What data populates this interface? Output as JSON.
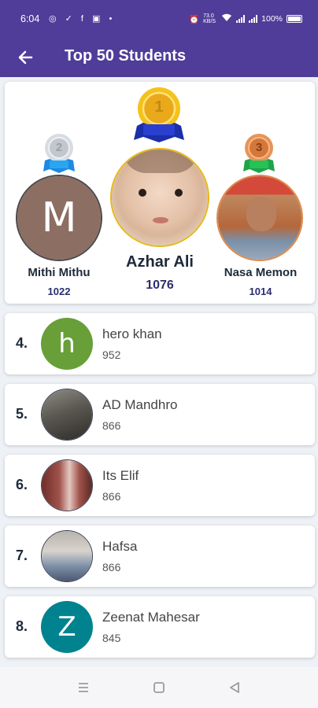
{
  "status_bar": {
    "time": "6:04",
    "icons": "◎ ✓ f ▣ •",
    "network_speed": "73.0 KB/S",
    "battery": "100%"
  },
  "app_bar": {
    "title": "Top 50 Students",
    "back_icon": "arrow-left"
  },
  "podium": [
    {
      "rank": "2",
      "name": "Mithi Mithu",
      "score": "1022",
      "avatar_letter": "M",
      "medal": "silver",
      "avatar_color": "#8d6e63"
    },
    {
      "rank": "1",
      "name": "Azhar Ali",
      "score": "1076",
      "avatar_letter": "",
      "medal": "gold",
      "avatar_color": "#f3d9c6"
    },
    {
      "rank": "3",
      "name": "Nasa Memon",
      "score": "1014",
      "avatar_letter": "",
      "medal": "bronze",
      "avatar_color": "#b5673a"
    }
  ],
  "ranking": [
    {
      "position": "4.",
      "name": "hero khan",
      "score": "952",
      "avatar_letter": "h",
      "avatar_color": "#689f38"
    },
    {
      "position": "5.",
      "name": "AD Mandhro",
      "score": "866",
      "avatar_letter": "",
      "avatar_color": "#5a5850"
    },
    {
      "position": "6.",
      "name": "Its Elif",
      "score": "866",
      "avatar_letter": "",
      "avatar_color": "#a0524a"
    },
    {
      "position": "7.",
      "name": "Hafsa",
      "score": "866",
      "avatar_letter": "",
      "avatar_color": "#7d8fa8"
    },
    {
      "position": "8.",
      "name": "Zeenat Mahesar",
      "score": "845",
      "avatar_letter": "Z",
      "avatar_color": "#00838f"
    }
  ],
  "colors": {
    "primary": "#4f3d99",
    "gold": "#f4c21b",
    "silver": "#c8ccd2",
    "bronze": "#e08a4a"
  }
}
